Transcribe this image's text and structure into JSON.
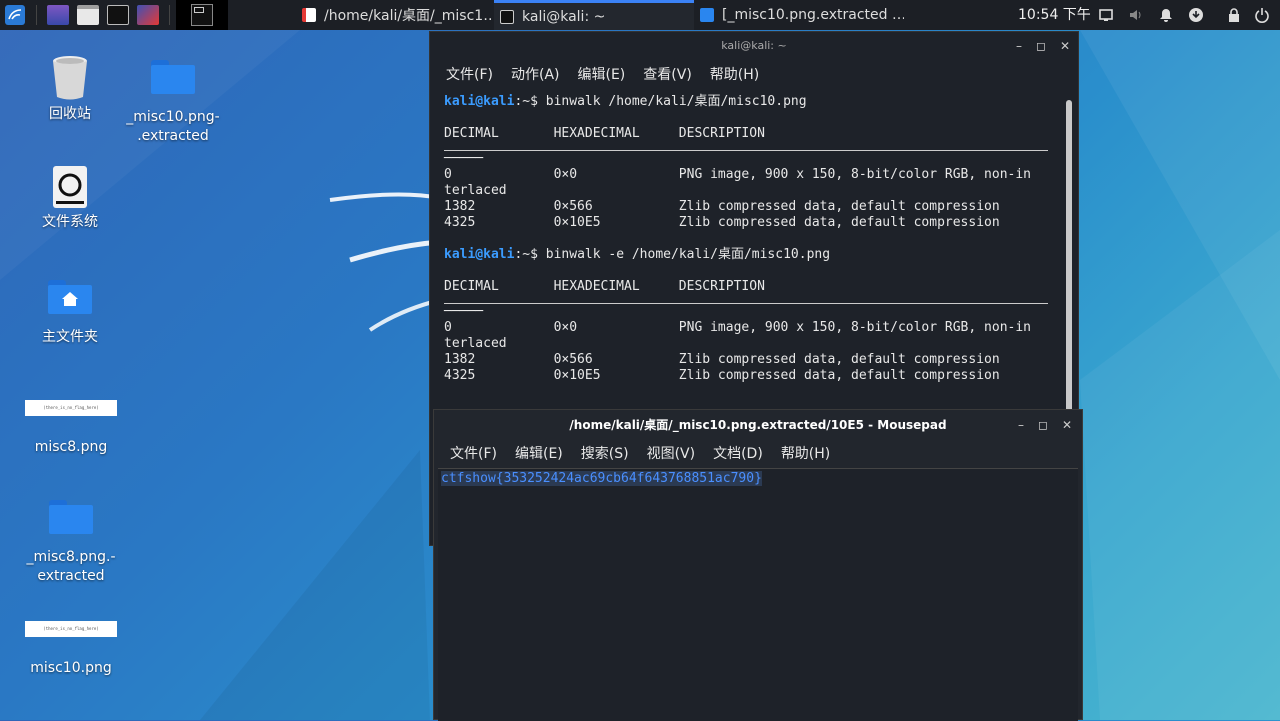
{
  "taskbar": {
    "tasks": [
      {
        "label": "/home/kali/桌面/_misc1…",
        "icon": "text-editor-icon"
      },
      {
        "label": "kali@kali: ~",
        "icon": "terminal-icon"
      },
      {
        "label": "[_misc10.png.extracted …",
        "icon": "folder-icon"
      }
    ],
    "clock": "10:54 下午"
  },
  "desktop": {
    "icons": [
      {
        "label": "回收站",
        "icon": "trash-icon"
      },
      {
        "label": "_misc10.png-\n.extracted",
        "icon": "folder-icon"
      },
      {
        "label": "文件系统",
        "icon": "drive-icon"
      },
      {
        "label": "主文件夹",
        "icon": "home-folder-icon"
      },
      {
        "label": "misc8.png",
        "icon": "image-thumbnail",
        "thumb_text": "(there_is_no_flag_here)"
      },
      {
        "label": "_misc8.png.-\nextracted",
        "icon": "folder-icon"
      },
      {
        "label": "misc10.png",
        "icon": "image-thumbnail",
        "thumb_text": "(there_is_no_flag_here)"
      }
    ]
  },
  "terminal": {
    "title": "kali@kali: ~",
    "menu": [
      "文件(F)",
      "动作(A)",
      "编辑(E)",
      "查看(V)",
      "帮助(H)"
    ],
    "prompt_user": "kali@kali",
    "prompt_suffix": ":~$",
    "cmd1": " binwalk /home/kali/桌面/misc10.png",
    "cmd2": " binwalk -e /home/kali/桌面/misc10.png",
    "header": "DECIMAL       HEXADECIMAL     DESCRIPTION",
    "short_rule": "─────",
    "rows": [
      "0             0×0             PNG image, 900 x 150, 8-bit/color RGB, non-in",
      "terlaced",
      "1382          0×566           Zlib compressed data, default compression",
      "4325          0×10E5          Zlib compressed data, default compression"
    ]
  },
  "mousepad": {
    "title": "/home/kali/桌面/_misc10.png.extracted/10E5 - Mousepad",
    "menu": [
      "文件(F)",
      "编辑(E)",
      "搜索(S)",
      "视图(V)",
      "文档(D)",
      "帮助(H)"
    ],
    "content": "ctfshow{353252424ac69cb64f643768851ac790}"
  },
  "colors": {
    "accent": "#3b82f6",
    "prompt": "#3b9cff",
    "selection_text": "#4a8fff"
  }
}
